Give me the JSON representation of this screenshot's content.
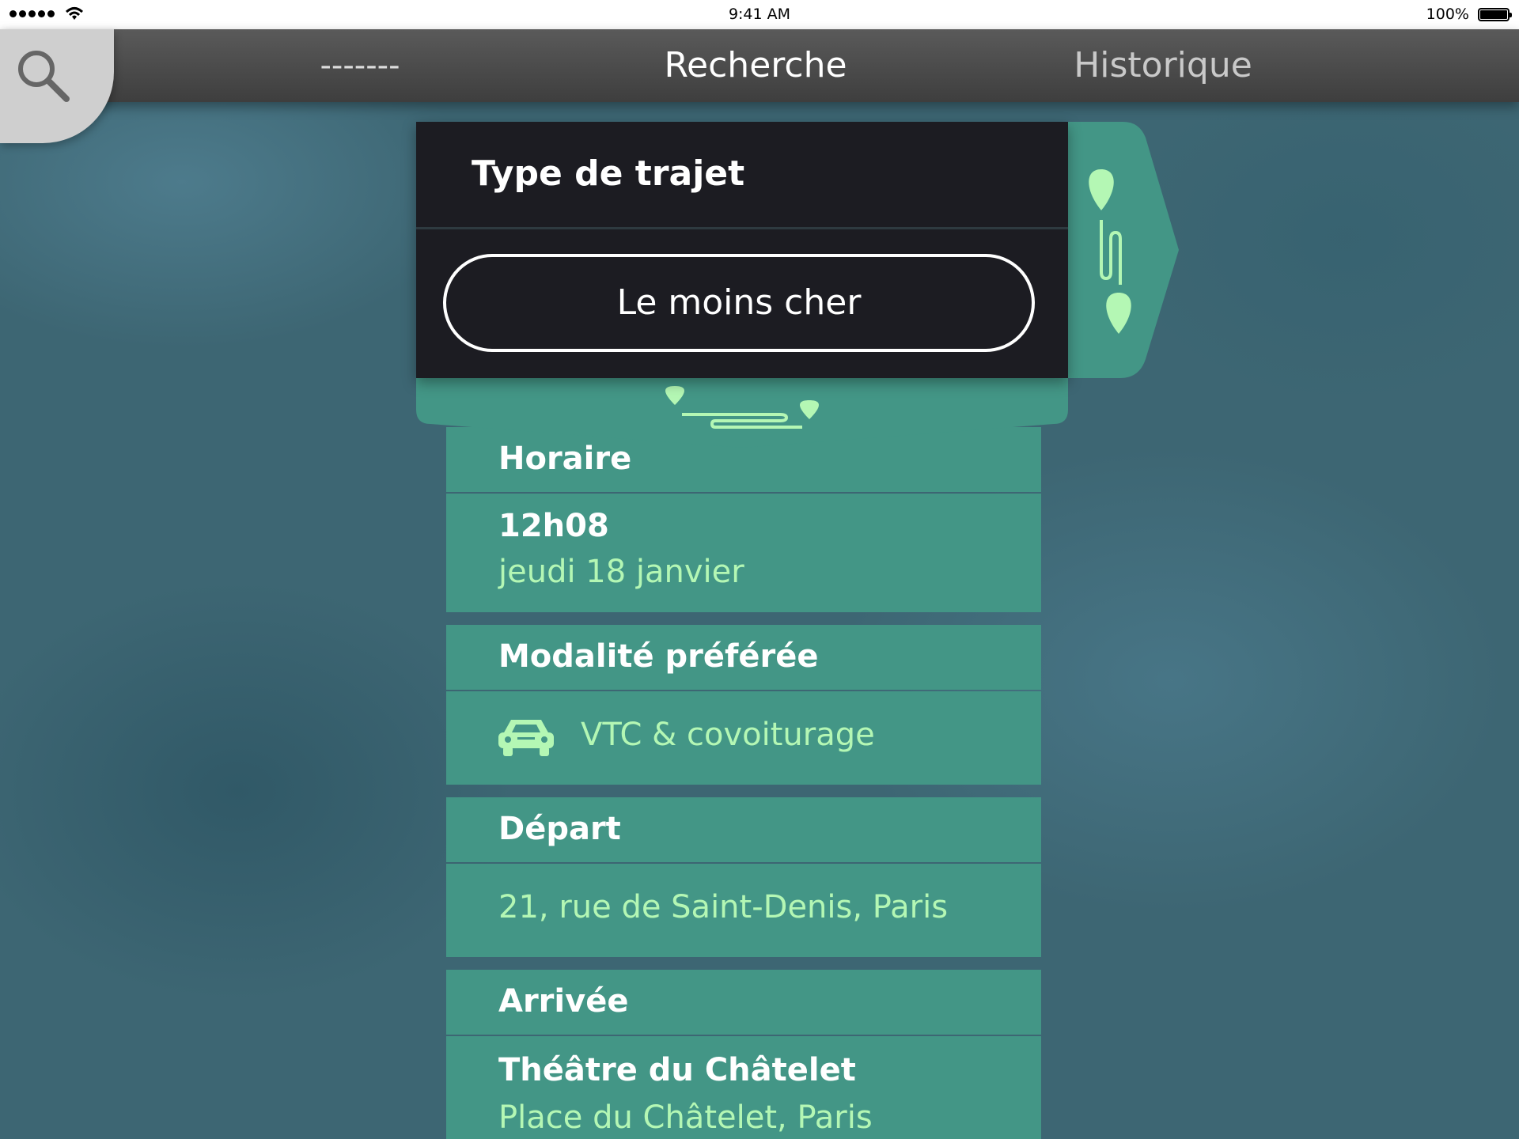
{
  "status": {
    "time": "9:41 AM",
    "battery": "100%"
  },
  "nav": {
    "left": "-------",
    "center": "Recherche",
    "right": "Historique"
  },
  "panel": {
    "title": "Type de trajet",
    "option": "Le moins cher"
  },
  "sections": {
    "horaire": {
      "label": "Horaire",
      "time": "12h08",
      "date": "jeudi 18 janvier"
    },
    "modalite": {
      "label": "Modalité préférée",
      "value": "VTC & covoiturage",
      "icon": "car-icon"
    },
    "depart": {
      "label": "Départ",
      "value": "21, rue de Saint-Denis, Paris"
    },
    "arrivee": {
      "label": "Arrivée",
      "place": "Théâtre du Châtelet",
      "address": "Place du Châtelet, Paris"
    }
  },
  "colors": {
    "accent": "#439686",
    "highlight": "#b4f7b4",
    "panel": "#1c1c22",
    "navbar": "#4a4a4a"
  }
}
